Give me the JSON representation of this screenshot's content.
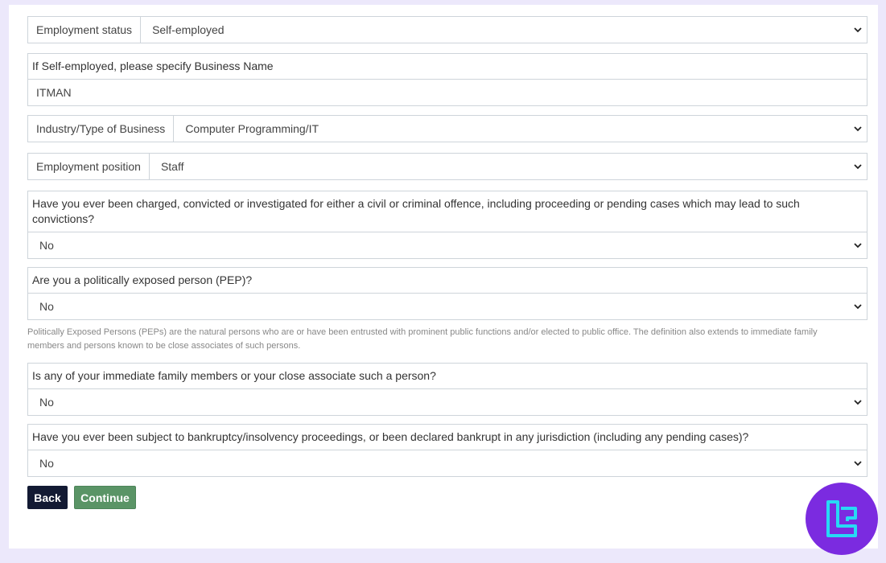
{
  "employment_status": {
    "label": "Employment status",
    "value": "Self-employed"
  },
  "business_name": {
    "label": "If Self-employed, please specify Business Name",
    "value": "ITMAN"
  },
  "industry": {
    "label": "Industry/Type of Business",
    "value": "Computer Programming/IT"
  },
  "position": {
    "label": "Employment position",
    "value": "Staff"
  },
  "criminal": {
    "label": "Have you ever been charged, convicted or investigated for either a civil or criminal offence, including proceeding or pending cases which may lead to such convictions?",
    "value": "No"
  },
  "pep": {
    "label": "Are you a politically exposed person (PEP)?",
    "value": "No"
  },
  "pep_help": "Politically Exposed Persons (PEPs) are the natural persons who are or have been entrusted with prominent public functions and/or elected to public office. The definition also extends to immediate family members and persons known to be close associates of such persons.",
  "family_pep": {
    "label": "Is any of your immediate family members or your close associate such a person?",
    "value": "No"
  },
  "bankruptcy": {
    "label": "Have you ever been subject to bankruptcy/insolvency proceedings, or been declared bankrupt in any jurisdiction (including any pending cases)?",
    "value": "No"
  },
  "buttons": {
    "back": "Back",
    "continue": "Continue"
  },
  "colors": {
    "background": "#ece8fb",
    "back_button": "#131a33",
    "continue_button": "#5a9466",
    "logo": "#7b2be0",
    "logo_mark": "#27d9f5"
  },
  "icons": {
    "dropdown": "chevron-down-icon",
    "logo": "brand-logo-icon"
  }
}
